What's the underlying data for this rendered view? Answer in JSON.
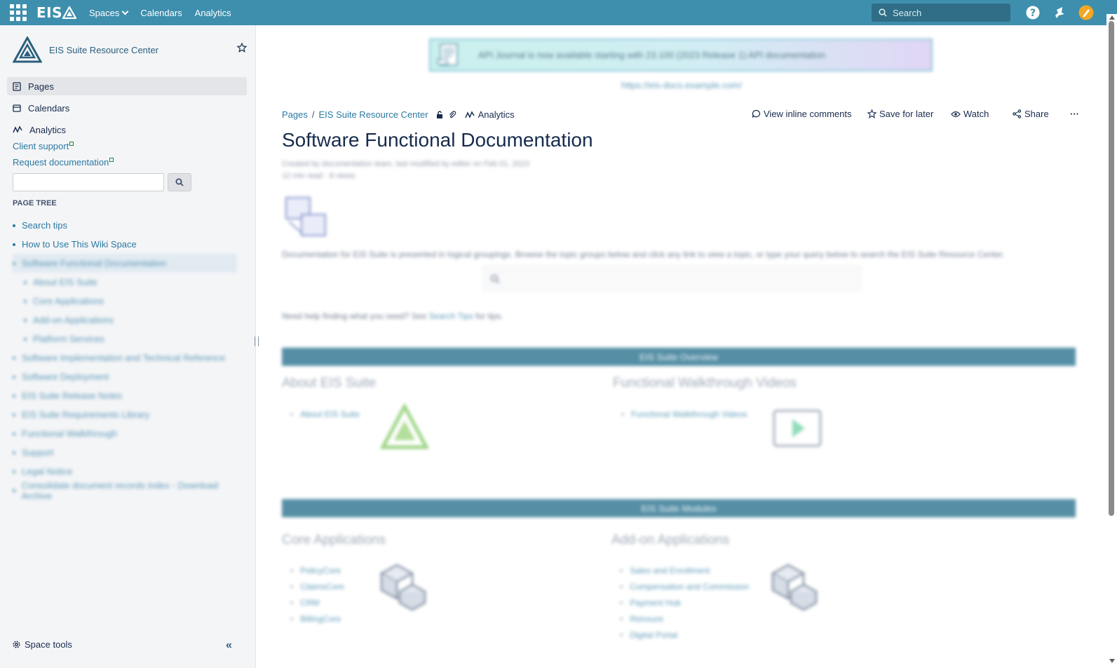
{
  "topbar": {
    "logo_text": "EIS",
    "nav": [
      "Spaces",
      "Calendars",
      "Analytics"
    ],
    "search_placeholder": "Search",
    "colors": {
      "bar": "#3d8fad",
      "help": "#ffffff",
      "avatar": "#f5a623"
    }
  },
  "sidebar": {
    "space_name": "EIS Suite Resource Center",
    "items": [
      {
        "label": "Pages",
        "icon": "pages-icon"
      },
      {
        "label": "Calendars",
        "icon": "calendar-icon"
      },
      {
        "label": "Analytics",
        "icon": "analytics-icon"
      }
    ],
    "links": [
      "Client support",
      "Request documentation"
    ],
    "tree_title": "PAGE TREE",
    "tree": [
      {
        "label": "Search tips",
        "blurred": false,
        "sub": false
      },
      {
        "label": "How to Use This Wiki Space",
        "blurred": false,
        "sub": false
      },
      {
        "label": "Software Functional Documentation",
        "blurred": true,
        "sub": false,
        "hl": true
      },
      {
        "label": "About EIS Suite",
        "blurred": true,
        "sub": true
      },
      {
        "label": "Core Applications",
        "blurred": true,
        "sub": true
      },
      {
        "label": "Add-on Applications",
        "blurred": true,
        "sub": true
      },
      {
        "label": "Platform Services",
        "blurred": true,
        "sub": true
      },
      {
        "label": "Software Implementation and Technical Reference",
        "blurred": true,
        "sub": false
      },
      {
        "label": "Software Deployment",
        "blurred": true,
        "sub": false
      },
      {
        "label": "EIS Suite Release Notes",
        "blurred": true,
        "sub": false
      },
      {
        "label": "EIS Suite Requirements Library",
        "blurred": true,
        "sub": false
      },
      {
        "label": "Functional Walkthrough",
        "blurred": true,
        "sub": false
      },
      {
        "label": "Support",
        "blurred": true,
        "sub": false
      },
      {
        "label": "Legal Notice",
        "blurred": true,
        "sub": false
      },
      {
        "label": "Consolidate document records index - Download Archive",
        "blurred": true,
        "sub": false
      }
    ],
    "space_tools": "Space tools",
    "collapse": "«"
  },
  "main": {
    "banner_text": "API Journal is now available starting with 23.100 (2023 Release 1) API documentation",
    "banner_link": "https://eis-docs.example.com/",
    "breadcrumb": [
      "Pages",
      "EIS Suite Resource Center"
    ],
    "breadcrumb_analytics": "Analytics",
    "actions": {
      "comments": "View inline comments",
      "save": "Save for later",
      "watch": "Watch",
      "share": "Share",
      "more": "···"
    },
    "title": "Software Functional Documentation",
    "meta": [
      "Created by documentation team, last modified by editor on Feb 01, 2023",
      "12 min read · 8 views"
    ],
    "intro": "Documentation for EIS Suite is presented in logical groupings. Browse the topic groups below and click any link to view a topic, or type your query below to search the EIS Suite Resource Center.",
    "help_prefix": "Need help finding what you need? See",
    "help_link": "Search Tips",
    "help_suffix": "for tips.",
    "sections": [
      {
        "bar": "EIS Suite Overview",
        "columns": [
          {
            "title": "About EIS Suite",
            "items": [
              "About EIS Suite"
            ],
            "icon": "eis-logo-icon"
          },
          {
            "title": "Functional Walkthrough Videos",
            "items": [
              "Functional Walkthrough Videos"
            ],
            "icon": "video-play-icon"
          }
        ]
      },
      {
        "bar": "EIS Suite Modules",
        "columns": [
          {
            "title": "Core Applications",
            "items": [
              "PolicyCore",
              "ClaimsCore",
              "CRM",
              "BillingCore"
            ],
            "icon": "boxes-icon"
          },
          {
            "title": "Add-on Applications",
            "items": [
              "Sales and Enrollment",
              "Compensation and Commission",
              "Payment Hub",
              "Reinsure",
              "Digital Portal"
            ],
            "icon": "boxes-icon"
          }
        ]
      }
    ]
  }
}
